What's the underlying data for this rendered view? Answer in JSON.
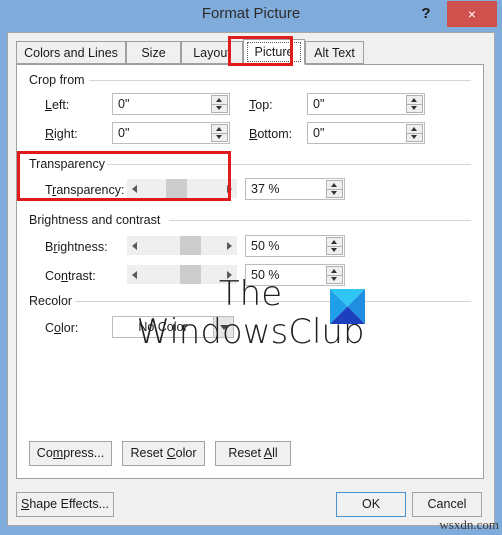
{
  "window": {
    "title": "Format Picture",
    "help_label": "?",
    "close_label": "×"
  },
  "tabs": [
    {
      "label": "Colors and Lines",
      "selected": false
    },
    {
      "label": "Size",
      "selected": false
    },
    {
      "label": "Layout",
      "selected": false
    },
    {
      "label": "Picture",
      "selected": true
    },
    {
      "label": "Alt Text",
      "selected": false
    }
  ],
  "crop_group": {
    "title": "Crop from",
    "fields": [
      {
        "label": "Left:",
        "accel": "L",
        "value": "0\""
      },
      {
        "label": "Right:",
        "accel": "R",
        "value": "0\""
      },
      {
        "label": "Top:",
        "accel": "T",
        "value": "0\""
      },
      {
        "label": "Bottom:",
        "accel": "B",
        "value": "0\""
      }
    ]
  },
  "transparency_group": {
    "title": "Transparency",
    "field_label": "Transparency:",
    "value": "37 %",
    "slider_percent": 37
  },
  "brightness_group": {
    "title": "Brightness and contrast",
    "brightness": {
      "label": "Brightness:",
      "value": "50 %",
      "slider_percent": 50
    },
    "contrast": {
      "label": "Contrast:",
      "value": "50 %",
      "slider_percent": 50
    }
  },
  "recolor_group": {
    "title": "Recolor",
    "field_label": "Color:",
    "selected_option": "No Color",
    "options": [
      "No Color"
    ]
  },
  "preview": {
    "logo_line1": "The",
    "logo_line2": "WindowsClub",
    "logo_mark_colors": {
      "top": "#2fc6f3",
      "left": "#1f9fe8",
      "right": "#1f8ee0",
      "bottom": "#1b3fbd"
    }
  },
  "panel_buttons": [
    {
      "label": "Compress...",
      "accel": "m"
    },
    {
      "label": "Reset Color",
      "accel": "C"
    },
    {
      "label": "Reset All",
      "accel": "A"
    }
  ],
  "footer_buttons": {
    "shape_effects": {
      "label": "Shape Effects...",
      "accel": "S"
    },
    "ok": {
      "label": "OK",
      "default": true
    },
    "cancel": {
      "label": "Cancel",
      "default": false
    }
  },
  "annotations": [
    {
      "target": "picture-tab"
    },
    {
      "target": "transparency-group"
    }
  ],
  "watermark": "wsxdn.com",
  "colors": {
    "titlebar": "#7facdb",
    "close_button": "#d0504e",
    "annotation": "#e01b1b",
    "dialog_face": "#f0f0f0",
    "panel": "#ffffff",
    "focus_border": "#4a93d1"
  }
}
